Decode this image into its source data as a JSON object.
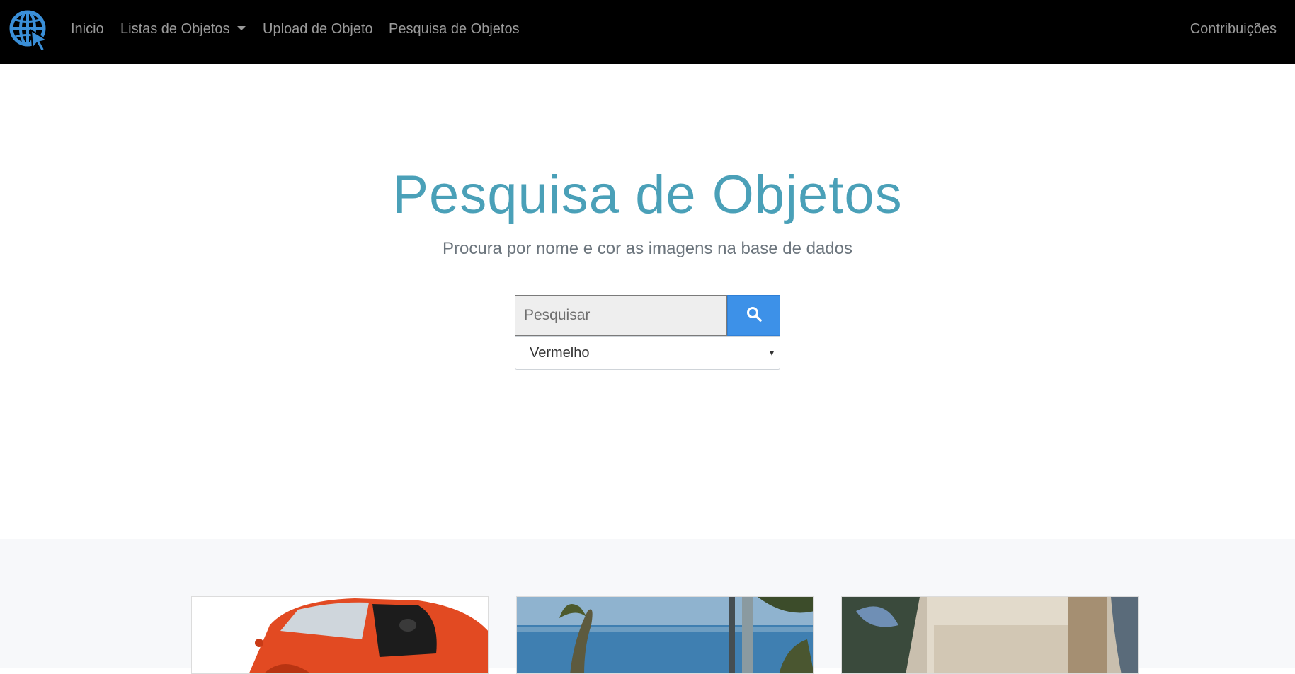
{
  "navbar": {
    "logo_icon": "globe-cursor-icon",
    "links": [
      {
        "label": "Inicio"
      },
      {
        "label": "Listas de Objetos"
      },
      {
        "label": "Upload de Objeto"
      },
      {
        "label": "Pesquisa de Objetos"
      }
    ],
    "right_link": "Contribuições",
    "colors": {
      "background": "#000000",
      "link": "#9a9a9a",
      "logo": "#3a8fd8"
    }
  },
  "hero": {
    "title": "Pesquisa de Objetos",
    "subtitle": "Procura por nome e cor as imagens na base de dados",
    "search": {
      "placeholder": "Pesquisar",
      "value": "",
      "button_icon": "search-icon"
    },
    "color_select": {
      "selected": "Vermelho"
    },
    "colors": {
      "title": "#4aa0b8",
      "button": "#3d91e8"
    }
  },
  "gallery": {
    "cards": [
      {
        "image": "red-car-photo"
      },
      {
        "image": "sea-palm-photo"
      },
      {
        "image": "stone-building-photo"
      }
    ]
  }
}
